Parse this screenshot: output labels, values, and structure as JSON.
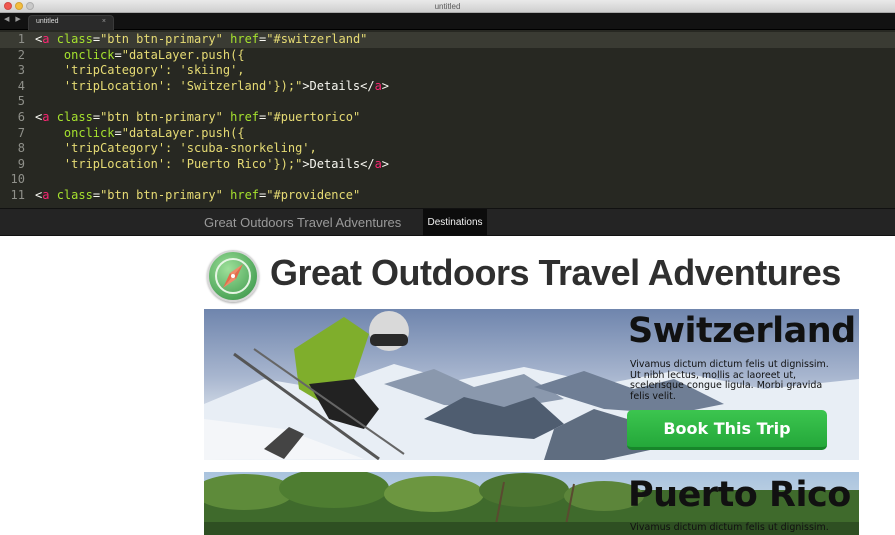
{
  "window": {
    "title": "untitled",
    "tab_label": "untitled",
    "tab_close": "×",
    "nav_arrows": "◀ ▶",
    "colors": {
      "editor_bg": "#272822",
      "tag": "#f92672",
      "attr": "#a6e22e",
      "string": "#e6db74"
    }
  },
  "editor": {
    "current_line": 1,
    "lines": [
      {
        "num": "1",
        "tokens": [
          {
            "t": "w",
            "v": "<"
          },
          {
            "t": "k",
            "v": "a"
          },
          {
            "t": "w",
            "v": " "
          },
          {
            "t": "a",
            "v": "class"
          },
          {
            "t": "w",
            "v": "="
          },
          {
            "t": "s",
            "v": "\"btn btn-primary\""
          },
          {
            "t": "w",
            "v": " "
          },
          {
            "t": "a",
            "v": "href"
          },
          {
            "t": "w",
            "v": "="
          },
          {
            "t": "s",
            "v": "\"#switzerland\""
          }
        ]
      },
      {
        "num": "2",
        "tokens": [
          {
            "t": "w",
            "v": "    "
          },
          {
            "t": "a",
            "v": "onclick"
          },
          {
            "t": "w",
            "v": "="
          },
          {
            "t": "s",
            "v": "\"dataLayer.push({"
          }
        ]
      },
      {
        "num": "3",
        "tokens": [
          {
            "t": "s",
            "v": "    'tripCategory': 'skiing',"
          }
        ]
      },
      {
        "num": "4",
        "tokens": [
          {
            "t": "s",
            "v": "    'tripLocation': 'Switzerland'});\""
          },
          {
            "t": "w",
            "v": ">Details</"
          },
          {
            "t": "k",
            "v": "a"
          },
          {
            "t": "w",
            "v": ">"
          }
        ]
      },
      {
        "num": "5",
        "tokens": []
      },
      {
        "num": "6",
        "tokens": [
          {
            "t": "w",
            "v": "<"
          },
          {
            "t": "k",
            "v": "a"
          },
          {
            "t": "w",
            "v": " "
          },
          {
            "t": "a",
            "v": "class"
          },
          {
            "t": "w",
            "v": "="
          },
          {
            "t": "s",
            "v": "\"btn btn-primary\""
          },
          {
            "t": "w",
            "v": " "
          },
          {
            "t": "a",
            "v": "href"
          },
          {
            "t": "w",
            "v": "="
          },
          {
            "t": "s",
            "v": "\"#puertorico\""
          }
        ]
      },
      {
        "num": "7",
        "tokens": [
          {
            "t": "w",
            "v": "    "
          },
          {
            "t": "a",
            "v": "onclick"
          },
          {
            "t": "w",
            "v": "="
          },
          {
            "t": "s",
            "v": "\"dataLayer.push({"
          }
        ]
      },
      {
        "num": "8",
        "tokens": [
          {
            "t": "s",
            "v": "    'tripCategory': 'scuba-snorkeling',"
          }
        ]
      },
      {
        "num": "9",
        "tokens": [
          {
            "t": "s",
            "v": "    'tripLocation': 'Puerto Rico'});\""
          },
          {
            "t": "w",
            "v": ">Details</"
          },
          {
            "t": "k",
            "v": "a"
          },
          {
            "t": "w",
            "v": ">"
          }
        ]
      },
      {
        "num": "10",
        "tokens": []
      },
      {
        "num": "11",
        "tokens": [
          {
            "t": "w",
            "v": "<"
          },
          {
            "t": "k",
            "v": "a"
          },
          {
            "t": "w",
            "v": " "
          },
          {
            "t": "a",
            "v": "class"
          },
          {
            "t": "w",
            "v": "="
          },
          {
            "t": "s",
            "v": "\"btn btn-primary\""
          },
          {
            "t": "w",
            "v": " "
          },
          {
            "t": "a",
            "v": "href"
          },
          {
            "t": "w",
            "v": "="
          },
          {
            "t": "s",
            "v": "\"#providence\""
          }
        ]
      }
    ]
  },
  "site": {
    "brand": "Great Outdoors Travel Adventures",
    "nav_destinations": "Destinations",
    "logo_icon": "compass-icon",
    "page_title": "Great Outdoors Travel Adventures",
    "cards": {
      "switzerland": {
        "title": "Switzerland",
        "text": "Vivamus dictum dictum felis ut dignissim. Ut nibh lectus, mollis ac laoreet ut, scelerisque congue ligula. Morbi gravida felis velit.",
        "button": "Book This Trip",
        "image": "skier-on-mountain-photo"
      },
      "puerto_rico": {
        "title": "Puerto Rico",
        "text": "Vivamus dictum dictum felis ut dignissim.",
        "image": "palm-trees-photo"
      }
    },
    "colors": {
      "navbar": "#242424",
      "button": "#2db744"
    }
  }
}
